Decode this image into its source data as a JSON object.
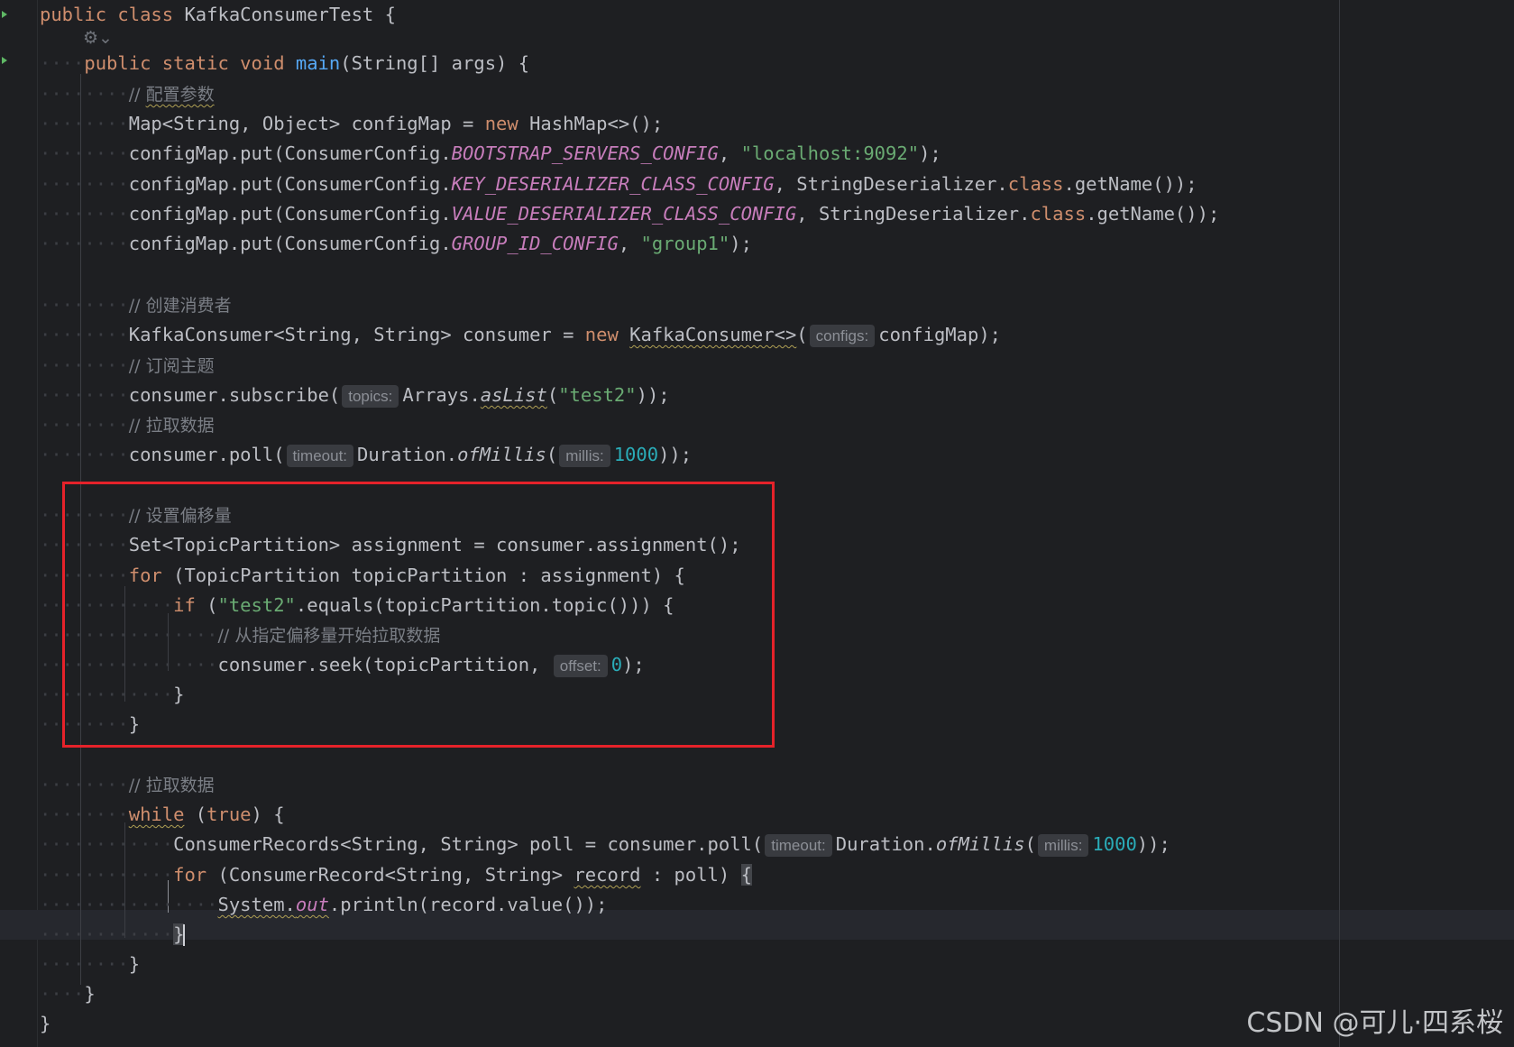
{
  "editor": {
    "class_name": "KafkaConsumerTest",
    "method_name": "main",
    "comments": {
      "config": "配置参数",
      "create": "创建消费者",
      "subscribe": "订阅主题",
      "fetch": "拉取数据",
      "offset": "设置偏移量",
      "seek": "从指定偏移量开始拉取数据",
      "fetch2": "拉取数据"
    },
    "constants": {
      "bootstrap": "BOOTSTRAP_SERVERS_CONFIG",
      "key_deser": "KEY_DESERIALIZER_CLASS_CONFIG",
      "value_deser": "VALUE_DESERIALIZER_CLASS_CONFIG",
      "group_id": "GROUP_ID_CONFIG"
    },
    "strings": {
      "bootstrap_server": "\"localhost:9092\"",
      "group": "\"group1\"",
      "topic": "\"test2\"",
      "topic_cmp": "\"test2\""
    },
    "numbers": {
      "timeout1": "1000",
      "offset": "0",
      "timeout2": "1000"
    },
    "hints": {
      "configs": "configs:",
      "topics": "topics:",
      "timeout": "timeout:",
      "millis": "millis:",
      "offset": "offset:"
    }
  },
  "watermark": "CSDN @可儿·四系桜"
}
